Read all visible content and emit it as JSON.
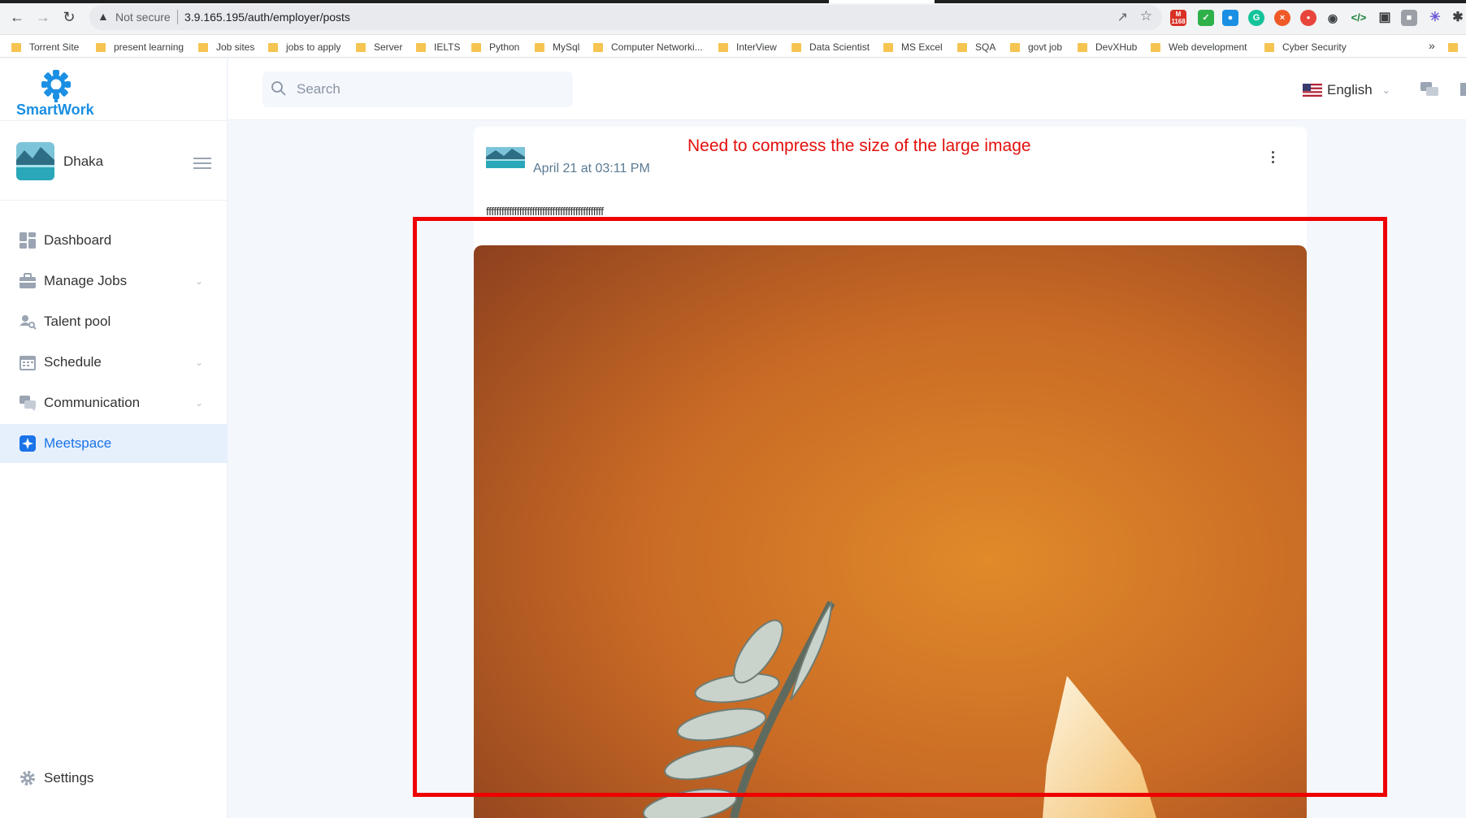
{
  "browser": {
    "address_warning": "Not secure",
    "url": "3.9.165.195/auth/employer/posts",
    "extension_badge": "1168",
    "bookmarks": [
      "Torrent Site",
      "present learning",
      "Job sites",
      "jobs to apply",
      "Server",
      "IELTS",
      "Python",
      "MySql",
      "Computer Networki...",
      "InterView",
      "Data Scientist",
      "MS Excel",
      "SQA",
      "govt job",
      "DevXHub",
      "Web development",
      "Cyber Security"
    ],
    "bookmarks_overflow": "»"
  },
  "sidebar": {
    "brand": "SmartWork",
    "user_name": "Dhaka",
    "nav": [
      {
        "label": "Dashboard",
        "icon": "dashboard-icon"
      },
      {
        "label": "Manage Jobs",
        "icon": "briefcase-icon"
      },
      {
        "label": "Talent pool",
        "icon": "user-search-icon"
      },
      {
        "label": "Schedule",
        "icon": "calendar-icon"
      },
      {
        "label": "Communication",
        "icon": "chat-icon"
      },
      {
        "label": "Meetspace",
        "icon": "meetspace-icon",
        "active": true
      }
    ],
    "settings_label": "Settings"
  },
  "topbar": {
    "search_placeholder": "Search",
    "language": "English"
  },
  "post": {
    "timestamp": "April 21 at 03:11 PM",
    "text": "ffffffffffffffffffffffffffffffffffffffffffffff"
  },
  "annotation": {
    "note": "Need to compress the size of the large image",
    "color": "#e3100c"
  }
}
